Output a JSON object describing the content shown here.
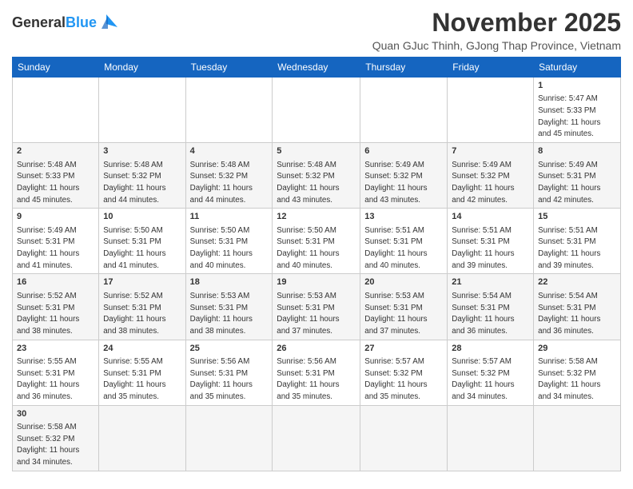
{
  "header": {
    "logo_general": "General",
    "logo_blue": "Blue",
    "month_title": "November 2025",
    "subtitle": "Quan GJuc Thinh, GJong Thap Province, Vietnam"
  },
  "weekdays": [
    "Sunday",
    "Monday",
    "Tuesday",
    "Wednesday",
    "Thursday",
    "Friday",
    "Saturday"
  ],
  "weeks": [
    [
      {
        "day": "",
        "info": ""
      },
      {
        "day": "",
        "info": ""
      },
      {
        "day": "",
        "info": ""
      },
      {
        "day": "",
        "info": ""
      },
      {
        "day": "",
        "info": ""
      },
      {
        "day": "",
        "info": ""
      },
      {
        "day": "1",
        "info": "Sunrise: 5:47 AM\nSunset: 5:33 PM\nDaylight: 11 hours\nand 45 minutes."
      }
    ],
    [
      {
        "day": "2",
        "info": "Sunrise: 5:48 AM\nSunset: 5:33 PM\nDaylight: 11 hours\nand 45 minutes."
      },
      {
        "day": "3",
        "info": "Sunrise: 5:48 AM\nSunset: 5:32 PM\nDaylight: 11 hours\nand 44 minutes."
      },
      {
        "day": "4",
        "info": "Sunrise: 5:48 AM\nSunset: 5:32 PM\nDaylight: 11 hours\nand 44 minutes."
      },
      {
        "day": "5",
        "info": "Sunrise: 5:48 AM\nSunset: 5:32 PM\nDaylight: 11 hours\nand 43 minutes."
      },
      {
        "day": "6",
        "info": "Sunrise: 5:49 AM\nSunset: 5:32 PM\nDaylight: 11 hours\nand 43 minutes."
      },
      {
        "day": "7",
        "info": "Sunrise: 5:49 AM\nSunset: 5:32 PM\nDaylight: 11 hours\nand 42 minutes."
      },
      {
        "day": "8",
        "info": "Sunrise: 5:49 AM\nSunset: 5:31 PM\nDaylight: 11 hours\nand 42 minutes."
      }
    ],
    [
      {
        "day": "9",
        "info": "Sunrise: 5:49 AM\nSunset: 5:31 PM\nDaylight: 11 hours\nand 41 minutes."
      },
      {
        "day": "10",
        "info": "Sunrise: 5:50 AM\nSunset: 5:31 PM\nDaylight: 11 hours\nand 41 minutes."
      },
      {
        "day": "11",
        "info": "Sunrise: 5:50 AM\nSunset: 5:31 PM\nDaylight: 11 hours\nand 40 minutes."
      },
      {
        "day": "12",
        "info": "Sunrise: 5:50 AM\nSunset: 5:31 PM\nDaylight: 11 hours\nand 40 minutes."
      },
      {
        "day": "13",
        "info": "Sunrise: 5:51 AM\nSunset: 5:31 PM\nDaylight: 11 hours\nand 40 minutes."
      },
      {
        "day": "14",
        "info": "Sunrise: 5:51 AM\nSunset: 5:31 PM\nDaylight: 11 hours\nand 39 minutes."
      },
      {
        "day": "15",
        "info": "Sunrise: 5:51 AM\nSunset: 5:31 PM\nDaylight: 11 hours\nand 39 minutes."
      }
    ],
    [
      {
        "day": "16",
        "info": "Sunrise: 5:52 AM\nSunset: 5:31 PM\nDaylight: 11 hours\nand 38 minutes."
      },
      {
        "day": "17",
        "info": "Sunrise: 5:52 AM\nSunset: 5:31 PM\nDaylight: 11 hours\nand 38 minutes."
      },
      {
        "day": "18",
        "info": "Sunrise: 5:53 AM\nSunset: 5:31 PM\nDaylight: 11 hours\nand 38 minutes."
      },
      {
        "day": "19",
        "info": "Sunrise: 5:53 AM\nSunset: 5:31 PM\nDaylight: 11 hours\nand 37 minutes."
      },
      {
        "day": "20",
        "info": "Sunrise: 5:53 AM\nSunset: 5:31 PM\nDaylight: 11 hours\nand 37 minutes."
      },
      {
        "day": "21",
        "info": "Sunrise: 5:54 AM\nSunset: 5:31 PM\nDaylight: 11 hours\nand 36 minutes."
      },
      {
        "day": "22",
        "info": "Sunrise: 5:54 AM\nSunset: 5:31 PM\nDaylight: 11 hours\nand 36 minutes."
      }
    ],
    [
      {
        "day": "23",
        "info": "Sunrise: 5:55 AM\nSunset: 5:31 PM\nDaylight: 11 hours\nand 36 minutes."
      },
      {
        "day": "24",
        "info": "Sunrise: 5:55 AM\nSunset: 5:31 PM\nDaylight: 11 hours\nand 35 minutes."
      },
      {
        "day": "25",
        "info": "Sunrise: 5:56 AM\nSunset: 5:31 PM\nDaylight: 11 hours\nand 35 minutes."
      },
      {
        "day": "26",
        "info": "Sunrise: 5:56 AM\nSunset: 5:31 PM\nDaylight: 11 hours\nand 35 minutes."
      },
      {
        "day": "27",
        "info": "Sunrise: 5:57 AM\nSunset: 5:32 PM\nDaylight: 11 hours\nand 35 minutes."
      },
      {
        "day": "28",
        "info": "Sunrise: 5:57 AM\nSunset: 5:32 PM\nDaylight: 11 hours\nand 34 minutes."
      },
      {
        "day": "29",
        "info": "Sunrise: 5:58 AM\nSunset: 5:32 PM\nDaylight: 11 hours\nand 34 minutes."
      }
    ],
    [
      {
        "day": "30",
        "info": "Sunrise: 5:58 AM\nSunset: 5:32 PM\nDaylight: 11 hours\nand 34 minutes."
      },
      {
        "day": "",
        "info": ""
      },
      {
        "day": "",
        "info": ""
      },
      {
        "day": "",
        "info": ""
      },
      {
        "day": "",
        "info": ""
      },
      {
        "day": "",
        "info": ""
      },
      {
        "day": "",
        "info": ""
      }
    ]
  ]
}
